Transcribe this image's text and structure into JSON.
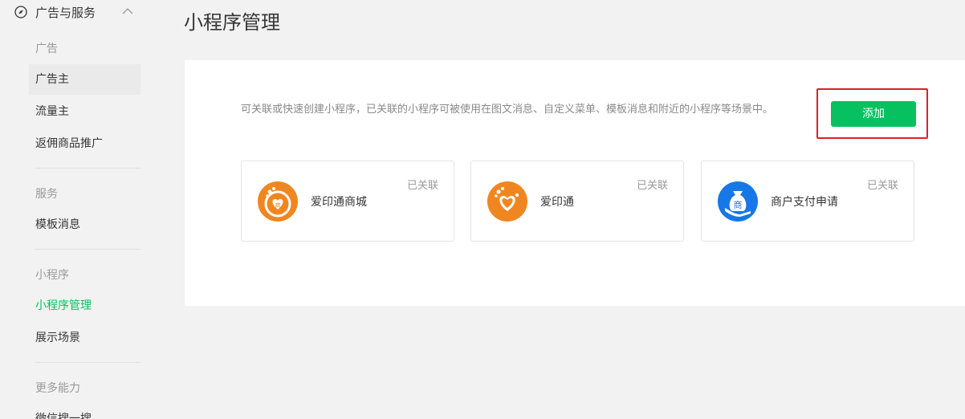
{
  "sidebar": {
    "header_title": "广告与服务",
    "groups": {
      "ads": "广告",
      "service": "服务",
      "miniprogram": "小程序",
      "more": "更多能力"
    },
    "items": {
      "advertiser": "广告主",
      "publisher": "流量主",
      "rebate": "返佣商品推广",
      "template_msg": "模板消息",
      "mp_manage": "小程序管理",
      "scene": "展示场景",
      "search": "微信搜一搜"
    }
  },
  "page": {
    "title": "小程序管理",
    "description": "可关联或快速创建小程序，已关联的小程序可被使用在图文消息、自定义菜单、模板消息和附近的小程序等场景中。",
    "add_label": "添加"
  },
  "cards": [
    {
      "name": "爱印通商城",
      "status": "已关联",
      "icon": "heart-note-badge-icon"
    },
    {
      "name": "爱印通",
      "status": "已关联",
      "icon": "heart-note-icon"
    },
    {
      "name": "商户支付申请",
      "status": "已关联",
      "icon": "money-bag-hand-icon"
    }
  ],
  "colors": {
    "accent": "#07c160",
    "highlight": "#e02020",
    "logo_orange": "#f0861f",
    "logo_blue": "#1677e6"
  }
}
